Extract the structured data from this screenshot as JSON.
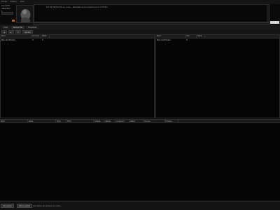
{
  "menu": {
    "items": [
      "Fichier",
      "Édition",
      "Aide"
    ]
  },
  "side_info": {
    "line1": "Connecté",
    "line2": "Utilisateur",
    "line3": "1"
  },
  "log": {
    "line": "[12:00] Recherche en cours… Résultats de la recherche pour le fichier"
  },
  "chat": {
    "placeholder": ""
  },
  "tabs": [
    {
      "label": "Chat"
    },
    {
      "label": "Recherche"
    },
    {
      "label": "Transferts"
    }
  ],
  "toolbar": {
    "b1": "◄",
    "b2": "►",
    "b3": "⟳",
    "b4": "Ajouter"
  },
  "left_pane": {
    "headers": [
      "Nom",
      "Sources",
      "Taille"
    ],
    "row": [
      "Nom de fichiers",
      "0",
      "0"
    ]
  },
  "right_pane": {
    "headers": [
      "Nom",
      "Info",
      "Taille"
    ],
    "row": [
      "Nom de fichiers",
      "0",
      ""
    ]
  },
  "results": {
    "headers": [
      "Nom",
      "Taille",
      "Type",
      "Titre",
      "Artiste",
      "Album",
      "Longueur",
      "Débit",
      "Source",
      "Fichiers"
    ]
  },
  "bottom": {
    "btn1": "Connecter",
    "btn2": "Déconnecter",
    "status": "Connexion au serveur en cours..."
  }
}
